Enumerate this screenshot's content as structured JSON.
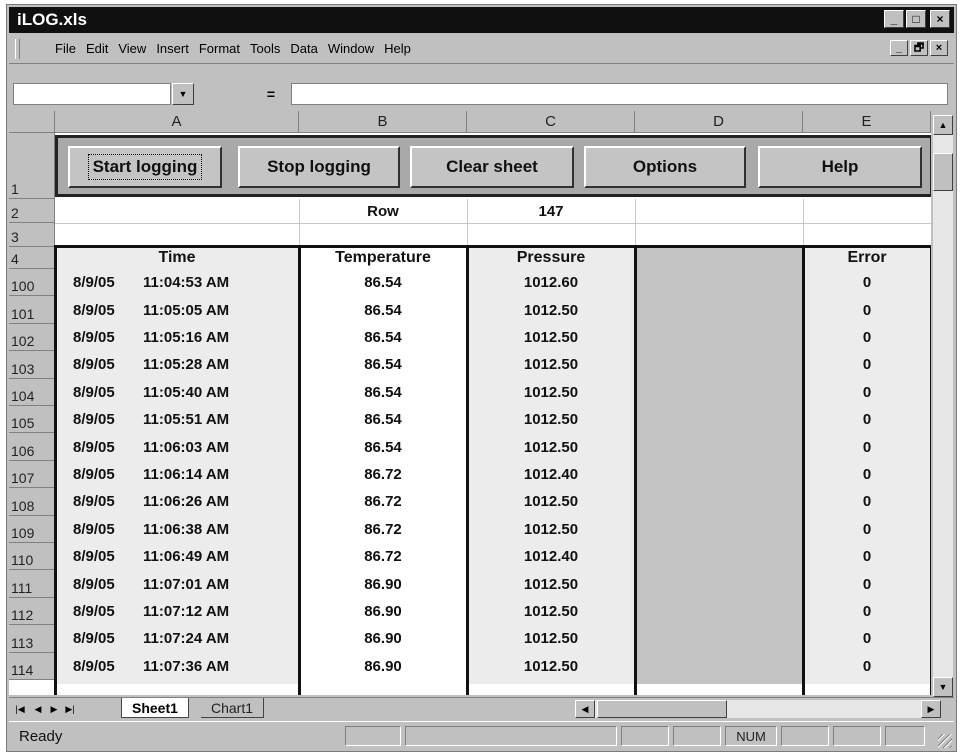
{
  "window": {
    "title": "iLOG.xls",
    "minimize": "_",
    "restore": "□",
    "close": "×"
  },
  "menubar": {
    "items": [
      {
        "label": "File",
        "key": "F"
      },
      {
        "label": "Edit",
        "key": "E"
      },
      {
        "label": "View",
        "key": "V"
      },
      {
        "label": "Insert",
        "key": "I"
      },
      {
        "label": "Format",
        "key": "o"
      },
      {
        "label": "Tools",
        "key": "T"
      },
      {
        "label": "Data",
        "key": "D"
      },
      {
        "label": "Window",
        "key": "W"
      },
      {
        "label": "Help",
        "key": "H"
      }
    ],
    "doc_minimize": "_",
    "doc_restore": "🗗",
    "doc_close": "×"
  },
  "formula_bar": {
    "name_box": "",
    "equals": "=",
    "formula": ""
  },
  "columns": [
    "A",
    "B",
    "C",
    "D",
    "E"
  ],
  "buttons": {
    "start": "Start logging",
    "stop": "Stop logging",
    "clear": "Clear sheet",
    "options": "Options",
    "help": "Help"
  },
  "row_headers_top": [
    "1",
    "2",
    "3",
    "4"
  ],
  "row2": {
    "label": "Row",
    "value": "147"
  },
  "table_headers": {
    "time": "Time",
    "temperature": "Temperature",
    "pressure": "Pressure",
    "error": "Error"
  },
  "rows": [
    {
      "num": "100",
      "date": "8/9/05",
      "time": "11:04:53 AM",
      "temp": "86.54",
      "pressure": "1012.60",
      "error": "0"
    },
    {
      "num": "101",
      "date": "8/9/05",
      "time": "11:05:05 AM",
      "temp": "86.54",
      "pressure": "1012.50",
      "error": "0"
    },
    {
      "num": "102",
      "date": "8/9/05",
      "time": "11:05:16 AM",
      "temp": "86.54",
      "pressure": "1012.50",
      "error": "0"
    },
    {
      "num": "103",
      "date": "8/9/05",
      "time": "11:05:28 AM",
      "temp": "86.54",
      "pressure": "1012.50",
      "error": "0"
    },
    {
      "num": "104",
      "date": "8/9/05",
      "time": "11:05:40 AM",
      "temp": "86.54",
      "pressure": "1012.50",
      "error": "0"
    },
    {
      "num": "105",
      "date": "8/9/05",
      "time": "11:05:51 AM",
      "temp": "86.54",
      "pressure": "1012.50",
      "error": "0"
    },
    {
      "num": "106",
      "date": "8/9/05",
      "time": "11:06:03 AM",
      "temp": "86.54",
      "pressure": "1012.50",
      "error": "0"
    },
    {
      "num": "107",
      "date": "8/9/05",
      "time": "11:06:14 AM",
      "temp": "86.72",
      "pressure": "1012.40",
      "error": "0"
    },
    {
      "num": "108",
      "date": "8/9/05",
      "time": "11:06:26 AM",
      "temp": "86.72",
      "pressure": "1012.50",
      "error": "0"
    },
    {
      "num": "109",
      "date": "8/9/05",
      "time": "11:06:38 AM",
      "temp": "86.72",
      "pressure": "1012.50",
      "error": "0"
    },
    {
      "num": "110",
      "date": "8/9/05",
      "time": "11:06:49 AM",
      "temp": "86.72",
      "pressure": "1012.40",
      "error": "0"
    },
    {
      "num": "111",
      "date": "8/9/05",
      "time": "11:07:01 AM",
      "temp": "86.90",
      "pressure": "1012.50",
      "error": "0"
    },
    {
      "num": "112",
      "date": "8/9/05",
      "time": "11:07:12 AM",
      "temp": "86.90",
      "pressure": "1012.50",
      "error": "0"
    },
    {
      "num": "113",
      "date": "8/9/05",
      "time": "11:07:24 AM",
      "temp": "86.90",
      "pressure": "1012.50",
      "error": "0"
    },
    {
      "num": "114",
      "date": "8/9/05",
      "time": "11:07:36 AM",
      "temp": "86.90",
      "pressure": "1012.50",
      "error": "0"
    }
  ],
  "tabs": [
    "Sheet1",
    "Chart1"
  ],
  "status": {
    "text": "Ready",
    "num": "NUM"
  }
}
